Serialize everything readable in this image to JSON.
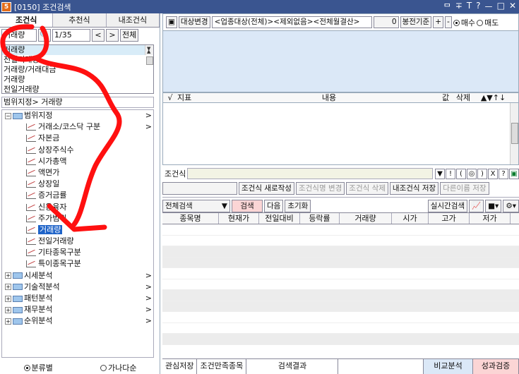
{
  "window": {
    "title": "[0150] 조건검색",
    "app_badge": "5",
    "controls": [
      "ᄆ",
      "∓",
      "T",
      "?",
      "ㅡ",
      "□",
      "✕"
    ]
  },
  "left": {
    "tabs": [
      {
        "label": "조건식",
        "active": true
      },
      {
        "label": "추천식",
        "active": false
      },
      {
        "label": "내조건식",
        "active": false
      }
    ],
    "search_value": "거래량",
    "page": "1/35",
    "all_button": "전체",
    "results": [
      "거래량",
      "전일거래량",
      "거래량/거래대금",
      "거래량",
      "전일거래량"
    ],
    "breadcrumb": "범위지정> 거래량",
    "tree": {
      "root": "범위지정",
      "children": [
        "거래소/코스닥 구분",
        "자본금",
        "상장주식수",
        "시가총액",
        "액면가",
        "상장일",
        "증거금률",
        "신용융자",
        "주가범위",
        "거래량",
        "전일거래량",
        "기타종목구분",
        "특이종목구분"
      ],
      "selected": "거래량",
      "others": [
        "시세분석",
        "기술적분석",
        "패턴분석",
        "재무분석",
        "순위분석"
      ]
    },
    "radio_category": "분류별",
    "radio_alpha": "가나다순"
  },
  "right": {
    "target_change": "대상변경",
    "condition_text": "<업종대상(전체)><제외없음><전체월결산>",
    "num_value": "0",
    "bong_label": "봉전기준",
    "plus": "+",
    "minus": "-",
    "buy": "매수",
    "sell": "매도",
    "grid_headers": {
      "check": "√",
      "indicator": "지표",
      "content": "내용",
      "value": "값",
      "delete": "삭제",
      "arrows": "▲▼↑↓"
    },
    "cond_label": "조건식",
    "cond_buttons": [
      "▼",
      "!",
      "(",
      "◎",
      ")",
      "X",
      "?",
      "▣"
    ],
    "new_cond": "조건식 새로작성",
    "name_change": "조건식명 변경",
    "cond_delete": "조건식 삭제",
    "my_save": "내조건식 저장",
    "save_as": "다른이름 저장",
    "search_scope": "전체검색",
    "search_btn": "검색",
    "next_btn": "다음",
    "reset_btn": "초기화",
    "realtime_btn": "실시간검색",
    "columns": [
      "종목명",
      "현재가",
      "전일대비",
      "등락률",
      "거래량",
      "시가",
      "고가",
      "저가"
    ],
    "bottom_tabs": [
      "관심저장",
      "조건만족종목",
      "검색결과",
      "비교분석",
      "성과검증"
    ]
  },
  "colors": {
    "titlebar": "#3a5590",
    "selected_tree": "#1e63c8",
    "annotation": "#ff1010",
    "query_area": "#dbe8f7"
  }
}
